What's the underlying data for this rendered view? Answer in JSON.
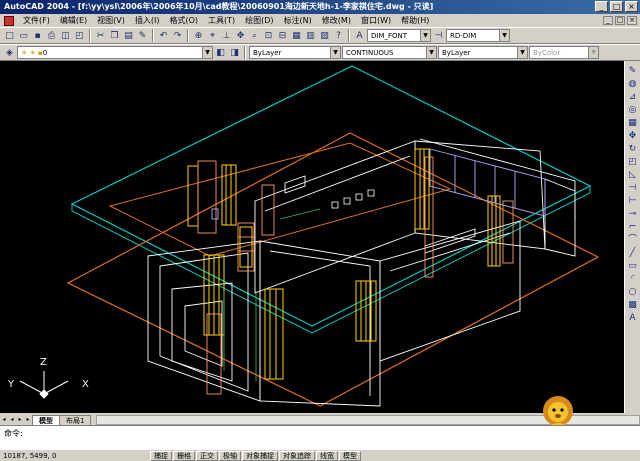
{
  "window": {
    "title": "AutoCAD 2004 - [f:\\yy\\ysl\\2006年\\2006年10月\\cad教程\\20060901海边新天地h-1-李家祺住宅.dwg - 只读]",
    "buttons": [
      "_",
      "□",
      "×"
    ]
  },
  "menu": [
    "文件(F)",
    "编辑(E)",
    "视图(V)",
    "插入(I)",
    "格式(O)",
    "工具(T)",
    "绘图(D)",
    "标注(N)",
    "修改(M)",
    "窗口(W)",
    "帮助(H)"
  ],
  "toolbar1": {
    "text_style": "DIM_FONT",
    "dim_style": "RD-DIM"
  },
  "toolbar2": {
    "layer": "0",
    "color": "ByLayer",
    "linetype": "CONTINUOUS",
    "lineweight": "ByLayer",
    "plotstyle": "ByColor"
  },
  "ucs": {
    "y": "Y",
    "x": "X",
    "z": "Z"
  },
  "tabs": [
    "模型",
    "布局1"
  ],
  "command": {
    "prompt": "命令:",
    "value": ""
  },
  "status": {
    "coords": "10187, 5499, 0",
    "toggles": [
      "捕捉",
      "栅格",
      "正交",
      "极轴",
      "对象捕捉",
      "对象追踪",
      "线宽",
      "模型"
    ]
  },
  "colors": {
    "titlebar": "#0a246a",
    "panel": "#d4d0c8",
    "cyan": "#00c8c8",
    "orange": "#e07020",
    "yellow": "#ffd200",
    "white": "#ffffff"
  }
}
